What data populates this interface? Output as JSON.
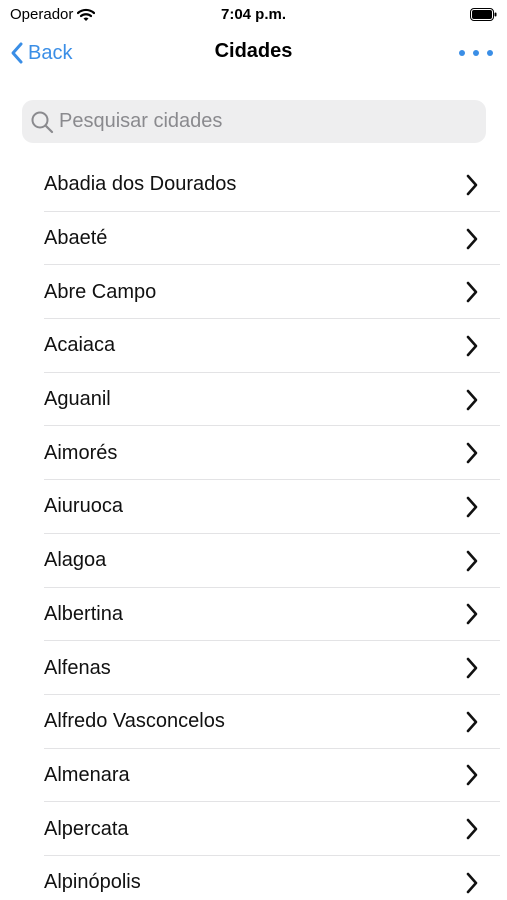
{
  "status_bar": {
    "carrier": "Operador",
    "time": "7:04 p.m.",
    "icons": [
      "wifi-icon",
      "battery-icon"
    ]
  },
  "nav": {
    "back_label": "Back",
    "title": "Cidades",
    "more_icon": "ellipsis-icon",
    "accent_color": "#3a8ee6"
  },
  "search": {
    "placeholder": "Pesquisar cidades",
    "value": "",
    "icon": "search-icon"
  },
  "cities": [
    {
      "label": "Abadia dos Dourados"
    },
    {
      "label": "Abaeté"
    },
    {
      "label": "Abre Campo"
    },
    {
      "label": "Acaiaca"
    },
    {
      "label": "Aguanil"
    },
    {
      "label": "Aimorés"
    },
    {
      "label": "Aiuruoca"
    },
    {
      "label": "Alagoa"
    },
    {
      "label": "Albertina"
    },
    {
      "label": "Alfenas"
    },
    {
      "label": "Alfredo Vasconcelos"
    },
    {
      "label": "Almenara"
    },
    {
      "label": "Alpercata"
    },
    {
      "label": "Alpinópolis"
    }
  ]
}
